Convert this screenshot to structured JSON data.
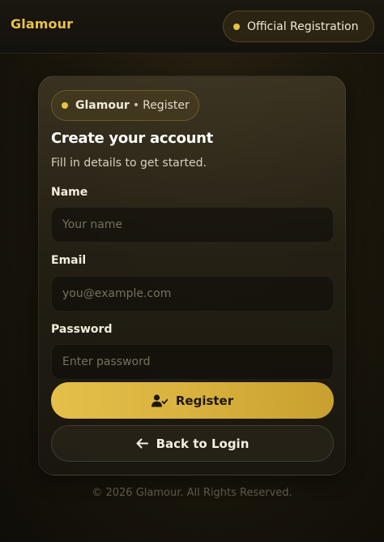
{
  "topbar": {
    "brand": "Glamour",
    "badge_label": "Official Registration"
  },
  "card": {
    "badge_brand": "Glamour",
    "badge_separator": "•",
    "badge_section": "Register",
    "title": "Create your account",
    "subtitle": "Fill in details to get started.",
    "fields": {
      "name": {
        "label": "Name",
        "placeholder": "Your name",
        "value": ""
      },
      "email": {
        "label": "Email",
        "placeholder": "you@example.com",
        "value": ""
      },
      "password": {
        "label": "Password",
        "placeholder": "Enter password",
        "value": ""
      }
    },
    "register_button": "Register",
    "back_button": "Back to Login"
  },
  "footer": "© 2026 Glamour. All Rights Reserved.",
  "icons": {
    "status_dot": "status-dot-icon",
    "register": "user-check-icon",
    "back": "arrow-left-icon"
  },
  "colors": {
    "accent": "#e9c247",
    "background": "#15120c",
    "primary_button": "#dab43f"
  }
}
